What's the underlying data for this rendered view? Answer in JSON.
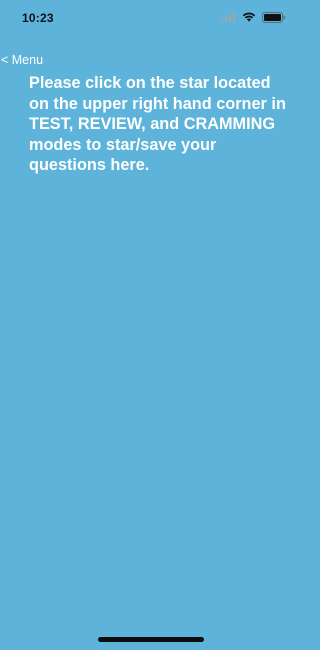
{
  "status_bar": {
    "time": "10:23",
    "icons": [
      "signal-bars-icon",
      "wifi-icon",
      "battery-icon"
    ],
    "text_color": "#111111"
  },
  "nav": {
    "back_label": "< Menu"
  },
  "main": {
    "message": "Please click on the star located on the upper right hand corner in TEST, REVIEW, and CRAMMING modes to star/save your questions here."
  },
  "colors": {
    "background": "#5db3d9",
    "text": "#ffffff",
    "home_indicator": "#0d0d0d"
  }
}
